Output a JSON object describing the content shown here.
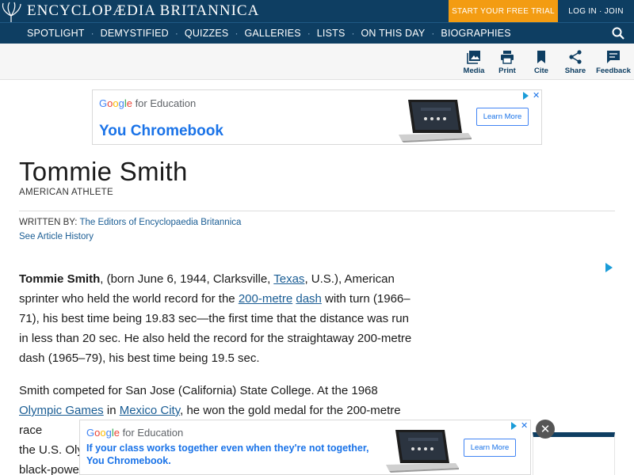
{
  "header": {
    "logo_text": "ENCYCLOPÆDIA BRITANNICA",
    "trial_label": "START YOUR FREE TRIAL",
    "login_label": "LOG IN · JOIN",
    "nav": [
      "SPOTLIGHT",
      "DEMYSTIFIED",
      "QUIZZES",
      "GALLERIES",
      "LISTS",
      "ON THIS DAY",
      "BIOGRAPHIES"
    ],
    "nav_sep": "·",
    "colors": {
      "navy": "#0e3e62",
      "orange": "#f39c12"
    }
  },
  "toolbar": {
    "items": [
      {
        "label": "Media",
        "icon": "media-icon"
      },
      {
        "label": "Print",
        "icon": "print-icon"
      },
      {
        "label": "Cite",
        "icon": "bookmark-icon"
      },
      {
        "label": "Share",
        "icon": "share-icon"
      },
      {
        "label": "Feedback",
        "icon": "feedback-icon"
      }
    ]
  },
  "ad_top": {
    "brand_g": [
      "G",
      "o",
      "o",
      "g",
      "l",
      "e"
    ],
    "brand_for": " for Education",
    "headline": "You Chromebook",
    "button": "Learn More",
    "close": "✕"
  },
  "article": {
    "title": "Tommie Smith",
    "subtitle": "AMERICAN ATHLETE",
    "written_by_label": "WRITTEN BY:",
    "written_by": "The Editors of Encyclopaedia Britannica",
    "history_link": "See Article History",
    "p1": {
      "name": "Tommie Smith",
      "t1": ", (born June 6, 1944, Clarksville, ",
      "link_texas": "Texas",
      "t2": ", U.S.), American sprinter who held the world record for the ",
      "link_200": "200-metre",
      "t3": " ",
      "link_dash": "dash",
      "t4": " with turn (1966–71), his best time being 19.83 sec—the first time that the distance was run in less than 20 sec. He also held the record for the straightaway 200-metre dash (1965–79), his best time being 19.5 sec."
    },
    "p2": {
      "t1": "Smith competed for San Jose (California) State College. At the 1968 ",
      "link_olympic": "Olympic Games",
      "t2": " in ",
      "link_mexico": "Mexico City",
      "t3": ", he won the gold medal for the 200-metre race",
      "t4": "the U.S. Oly",
      "t5": "black-powe"
    }
  },
  "ad_bottom": {
    "brand_g": [
      "G",
      "o",
      "o",
      "g",
      "l",
      "e"
    ],
    "brand_for": " for Education",
    "headline_line1": "If your class works together even when they're not together,",
    "headline_line2": "You Chromebook.",
    "button": "Learn More",
    "close": "✕",
    "dismiss": "✕"
  }
}
